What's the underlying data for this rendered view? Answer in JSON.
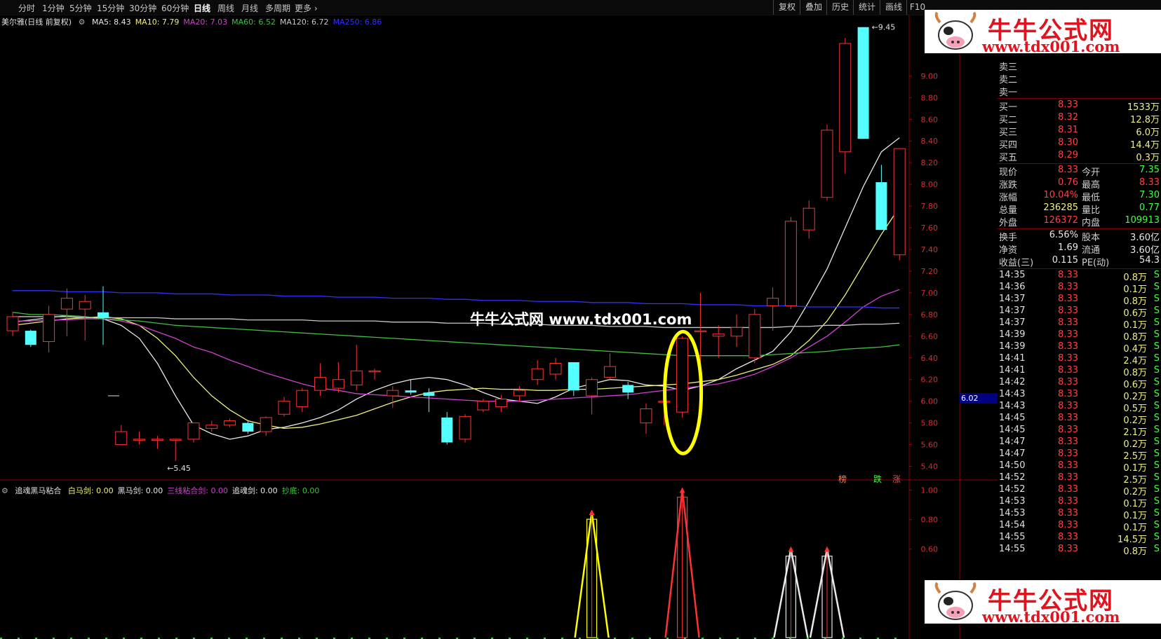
{
  "toolbar": {
    "periods": [
      "分时",
      "1分钟",
      "5分钟",
      "15分钟",
      "30分钟",
      "60分钟",
      "日线",
      "周线",
      "月线",
      "多周期",
      "更多"
    ],
    "active": "日线",
    "right_buttons": [
      "复权",
      "叠加",
      "历史",
      "统计",
      "画线",
      "F10"
    ]
  },
  "ma_legend": {
    "stock": "美尔雅(日线 前复权)",
    "items": [
      {
        "label": "MA5: 8.43",
        "color": "#e8e8e8"
      },
      {
        "label": "MA10: 7.79",
        "color": "#f0f07a"
      },
      {
        "label": "MA20: 7.03",
        "color": "#d040d0"
      },
      {
        "label": "MA60: 6.52",
        "color": "#40c040"
      },
      {
        "label": "MA120: 6.72",
        "color": "#c8c8c8"
      },
      {
        "label": "MA250: 6.86",
        "color": "#3030ff"
      }
    ]
  },
  "indicator_legend": {
    "name": "追魂黑马粘合",
    "items": [
      {
        "label": "白马剑: 0.00",
        "color": "#f0f07a"
      },
      {
        "label": "黑马剑: 0.00",
        "color": "#e8e8e8"
      },
      {
        "label": "三线粘合剑: 0.00",
        "color": "#d040d0"
      },
      {
        "label": "追魂剑: 0.00",
        "color": "#e8e8e8"
      },
      {
        "label": "抄底: 0.00",
        "color": "#40c040"
      }
    ]
  },
  "price_axis": {
    "ticks": [
      "9.00",
      "8.80",
      "8.60",
      "8.40",
      "8.20",
      "8.00",
      "7.80",
      "7.60",
      "7.40",
      "7.20",
      "7.00",
      "6.80",
      "6.60",
      "6.40",
      "6.20",
      "6.00",
      "5.80",
      "5.60",
      "5.40"
    ],
    "current": "6.02"
  },
  "indicator_axis": {
    "ticks": [
      "1.00",
      "0.80",
      "0.60"
    ]
  },
  "annotations": {
    "high": "9.45",
    "low": "5.45"
  },
  "signals": [
    {
      "text": "榜",
      "color": "#ff8040"
    },
    {
      "text": "跌",
      "color": "#40ff40"
    },
    {
      "text": "涨",
      "color": "#ff4040"
    }
  ],
  "watermark": "牛牛公式网  www.tdx001.com",
  "logo": {
    "title": "牛牛公式网",
    "url": "www.tdx001.com"
  },
  "colors": {
    "up": "#ff3232",
    "down": "#54ffff",
    "bg": "#000000"
  },
  "chart_data": [
    {
      "type": "candlestick",
      "ylim": [
        5.3,
        9.5
      ],
      "candles": [
        {
          "o": 6.65,
          "c": 6.78,
          "h": 6.82,
          "l": 6.6
        },
        {
          "o": 6.65,
          "c": 6.52,
          "h": 6.66,
          "l": 6.5
        },
        {
          "o": 6.55,
          "c": 6.8,
          "h": 6.88,
          "l": 6.45
        },
        {
          "o": 6.85,
          "c": 6.95,
          "h": 7.04,
          "l": 6.6
        },
        {
          "o": 6.85,
          "c": 6.92,
          "h": 6.98,
          "l": 6.56
        },
        {
          "o": 6.82,
          "c": 6.77,
          "h": 7.06,
          "l": 6.52
        },
        {
          "o": 5.6,
          "c": 5.72,
          "h": 5.78,
          "l": 5.6
        },
        {
          "o": 5.65,
          "c": 5.65,
          "h": 5.72,
          "l": 5.6
        },
        {
          "o": 5.65,
          "c": 5.65,
          "h": 5.68,
          "l": 5.56
        },
        {
          "o": 5.65,
          "c": 5.65,
          "h": 5.65,
          "l": 5.45
        },
        {
          "o": 5.65,
          "c": 5.8,
          "h": 5.8,
          "l": 5.62
        },
        {
          "o": 5.75,
          "c": 5.78,
          "h": 5.82,
          "l": 5.72
        },
        {
          "o": 5.78,
          "c": 5.82,
          "h": 5.84,
          "l": 5.76
        },
        {
          "o": 5.8,
          "c": 5.72,
          "h": 5.82,
          "l": 5.7
        },
        {
          "o": 5.72,
          "c": 5.85,
          "h": 5.86,
          "l": 5.68
        },
        {
          "o": 5.88,
          "c": 6.0,
          "h": 6.04,
          "l": 5.86
        },
        {
          "o": 5.95,
          "c": 6.1,
          "h": 6.12,
          "l": 5.9
        },
        {
          "o": 6.1,
          "c": 6.22,
          "h": 6.35,
          "l": 6.05
        },
        {
          "o": 6.12,
          "c": 6.2,
          "h": 6.36,
          "l": 6.08
        },
        {
          "o": 6.15,
          "c": 6.28,
          "h": 6.52,
          "l": 6.1
        },
        {
          "o": 6.28,
          "c": 6.28,
          "h": 6.3,
          "l": 6.2
        },
        {
          "o": 6.05,
          "c": 6.1,
          "h": 6.14,
          "l": 5.94
        },
        {
          "o": 6.1,
          "c": 6.08,
          "h": 6.2,
          "l": 6.06
        },
        {
          "o": 6.08,
          "c": 6.05,
          "h": 6.12,
          "l": 5.9
        },
        {
          "o": 5.85,
          "c": 5.62,
          "h": 5.9,
          "l": 5.6
        },
        {
          "o": 5.65,
          "c": 5.86,
          "h": 5.88,
          "l": 5.62
        },
        {
          "o": 5.92,
          "c": 6.0,
          "h": 6.02,
          "l": 5.9
        },
        {
          "o": 5.95,
          "c": 6.02,
          "h": 6.06,
          "l": 5.9
        },
        {
          "o": 6.05,
          "c": 6.1,
          "h": 6.14,
          "l": 6.0
        },
        {
          "o": 6.2,
          "c": 6.3,
          "h": 6.38,
          "l": 6.15
        },
        {
          "o": 6.25,
          "c": 6.35,
          "h": 6.4,
          "l": 6.2
        },
        {
          "o": 6.36,
          "c": 6.1,
          "h": 6.36,
          "l": 6.05
        },
        {
          "o": 6.05,
          "c": 6.2,
          "h": 6.22,
          "l": 5.88
        },
        {
          "o": 6.22,
          "c": 6.32,
          "h": 6.44,
          "l": 6.2
        },
        {
          "o": 6.15,
          "c": 6.08,
          "h": 6.18,
          "l": 6.02
        },
        {
          "o": 5.8,
          "c": 5.93,
          "h": 5.98,
          "l": 5.7
        },
        {
          "o": 6.0,
          "c": 6.0,
          "h": 6.2,
          "l": 5.78
        },
        {
          "o": 5.9,
          "c": 6.58,
          "h": 6.6,
          "l": 5.85
        },
        {
          "o": 6.65,
          "c": 6.65,
          "h": 7.0,
          "l": 6.3
        },
        {
          "o": 6.6,
          "c": 6.62,
          "h": 6.7,
          "l": 6.4
        },
        {
          "o": 6.6,
          "c": 6.68,
          "h": 6.8,
          "l": 6.5
        },
        {
          "o": 6.4,
          "c": 6.8,
          "h": 6.85,
          "l": 6.35
        },
        {
          "o": 6.88,
          "c": 6.95,
          "h": 7.05,
          "l": 6.65
        },
        {
          "o": 6.88,
          "c": 7.66,
          "h": 7.7,
          "l": 6.85
        },
        {
          "o": 7.58,
          "c": 7.78,
          "h": 7.85,
          "l": 7.5
        },
        {
          "o": 7.88,
          "c": 8.5,
          "h": 8.55,
          "l": 7.85
        },
        {
          "o": 8.3,
          "c": 9.3,
          "h": 9.35,
          "l": 8.1
        },
        {
          "o": 9.45,
          "c": 8.42,
          "h": 9.45,
          "l": 8.42
        },
        {
          "o": 8.02,
          "c": 7.58,
          "h": 8.18,
          "l": 7.58
        },
        {
          "o": 7.35,
          "c": 8.33,
          "h": 8.33,
          "l": 7.3
        }
      ],
      "moving_averages": {
        "MA5": [
          6.73,
          6.75,
          6.77,
          6.79,
          6.78,
          6.76,
          6.7,
          6.58,
          6.35,
          6.05,
          5.78,
          5.7,
          5.65,
          5.68,
          5.74,
          5.76,
          5.8,
          5.85,
          5.92,
          6.02,
          6.1,
          6.16,
          6.2,
          6.22,
          6.2,
          6.15,
          6.08,
          6.02,
          6.0,
          5.98,
          6.04,
          6.12,
          6.16,
          6.2,
          6.19,
          6.15,
          6.14,
          6.1,
          6.14,
          6.2,
          6.3,
          6.38,
          6.46,
          6.64,
          6.92,
          7.22,
          7.6,
          7.98,
          8.3,
          8.43
        ],
        "MA10": [
          6.7,
          6.72,
          6.74,
          6.76,
          6.77,
          6.78,
          6.76,
          6.7,
          6.58,
          6.42,
          6.22,
          6.05,
          5.92,
          5.82,
          5.78,
          5.75,
          5.76,
          5.79,
          5.83,
          5.87,
          5.93,
          5.99,
          6.04,
          6.08,
          6.1,
          6.11,
          6.12,
          6.11,
          6.11,
          6.1,
          6.1,
          6.11,
          6.11,
          6.12,
          6.13,
          6.14,
          6.15,
          6.16,
          6.18,
          6.2,
          6.24,
          6.29,
          6.34,
          6.42,
          6.56,
          6.74,
          6.98,
          7.26,
          7.54,
          7.79
        ],
        "MA20": [
          6.74,
          6.74,
          6.75,
          6.75,
          6.76,
          6.76,
          6.74,
          6.7,
          6.64,
          6.58,
          6.5,
          6.45,
          6.38,
          6.32,
          6.26,
          6.21,
          6.16,
          6.12,
          6.1,
          6.07,
          6.06,
          6.05,
          6.04,
          6.03,
          6.02,
          6.01,
          6.0,
          6.0,
          6.0,
          6.01,
          6.02,
          6.03,
          6.04,
          6.05,
          6.06,
          6.08,
          6.1,
          6.12,
          6.14,
          6.16,
          6.2,
          6.25,
          6.32,
          6.4,
          6.5,
          6.6,
          6.73,
          6.87,
          6.97,
          7.03
        ],
        "MA60": [
          6.82,
          6.8,
          6.8,
          6.79,
          6.78,
          6.76,
          6.75,
          6.74,
          6.72,
          6.7,
          6.69,
          6.68,
          6.67,
          6.66,
          6.65,
          6.64,
          6.63,
          6.62,
          6.61,
          6.6,
          6.59,
          6.58,
          6.57,
          6.56,
          6.55,
          6.54,
          6.53,
          6.52,
          6.51,
          6.5,
          6.49,
          6.48,
          6.47,
          6.46,
          6.45,
          6.44,
          6.43,
          6.42,
          6.42,
          6.42,
          6.42,
          6.42,
          6.43,
          6.44,
          6.45,
          6.46,
          6.48,
          6.49,
          6.5,
          6.52
        ],
        "MA120": [
          6.78,
          6.78,
          6.78,
          6.78,
          6.77,
          6.77,
          6.77,
          6.77,
          6.77,
          6.76,
          6.76,
          6.76,
          6.76,
          6.75,
          6.75,
          6.75,
          6.75,
          6.74,
          6.74,
          6.74,
          6.74,
          6.73,
          6.73,
          6.73,
          6.72,
          6.72,
          6.72,
          6.71,
          6.71,
          6.71,
          6.7,
          6.7,
          6.7,
          6.69,
          6.69,
          6.69,
          6.68,
          6.68,
          6.68,
          6.68,
          6.68,
          6.68,
          6.68,
          6.69,
          6.69,
          6.7,
          6.7,
          6.71,
          6.71,
          6.72
        ],
        "MA250": [
          7.02,
          7.02,
          7.02,
          7.01,
          7.01,
          7.01,
          7.0,
          7.0,
          7.0,
          6.99,
          6.99,
          6.99,
          6.98,
          6.98,
          6.98,
          6.97,
          6.97,
          6.97,
          6.96,
          6.96,
          6.96,
          6.95,
          6.95,
          6.95,
          6.94,
          6.94,
          6.93,
          6.93,
          6.93,
          6.92,
          6.92,
          6.92,
          6.91,
          6.91,
          6.91,
          6.9,
          6.9,
          6.9,
          6.89,
          6.89,
          6.89,
          6.88,
          6.88,
          6.88,
          6.87,
          6.87,
          6.87,
          6.87,
          6.86,
          6.86
        ]
      }
    },
    {
      "type": "bar",
      "name": "追魂黑马粘合",
      "ylim": [
        0,
        1.05
      ],
      "peaks": [
        {
          "index": 32,
          "value": 0.85,
          "color": "#ffff00"
        },
        {
          "index": 37,
          "value": 1.0,
          "color": "#ff3232"
        },
        {
          "index": 43,
          "value": 0.6,
          "color": "#e8e8e8"
        },
        {
          "index": 45,
          "value": 0.6,
          "color": "#e8e8e8"
        }
      ]
    }
  ],
  "order_book": {
    "asks": [
      {
        "label": "卖三",
        "price": "",
        "vol": ""
      },
      {
        "label": "卖二",
        "price": "",
        "vol": ""
      },
      {
        "label": "卖一",
        "price": "",
        "vol": ""
      }
    ],
    "bids": [
      {
        "label": "买一",
        "price": "8.33",
        "vol": "1533万"
      },
      {
        "label": "买二",
        "price": "8.32",
        "vol": "12.8万"
      },
      {
        "label": "买三",
        "price": "8.31",
        "vol": "6.0万"
      },
      {
        "label": "买四",
        "price": "8.30",
        "vol": "14.4万"
      },
      {
        "label": "买五",
        "price": "8.29",
        "vol": "0.3万"
      }
    ]
  },
  "quote": [
    {
      "l1": "现价",
      "v1": "8.33",
      "c1": "#ff4040",
      "l2": "今开",
      "v2": "7.35",
      "c2": "#40ff40"
    },
    {
      "l1": "涨跌",
      "v1": "0.76",
      "c1": "#ff4040",
      "l2": "最高",
      "v2": "8.33",
      "c2": "#ff4040"
    },
    {
      "l1": "涨幅",
      "v1": "10.04%",
      "c1": "#ff4040",
      "l2": "最低",
      "v2": "7.30",
      "c2": "#40ff40"
    },
    {
      "l1": "总量",
      "v1": "236285",
      "c1": "#f0f07a",
      "l2": "量比",
      "v2": "0.77",
      "c2": "#40ff40"
    },
    {
      "l1": "外盘",
      "v1": "126372",
      "c1": "#ff4040",
      "l2": "内盘",
      "v2": "109913",
      "c2": "#40ff40"
    }
  ],
  "fundamentals": [
    {
      "l1": "换手",
      "v1": "6.56%",
      "l2": "股本",
      "v2": "3.60亿"
    },
    {
      "l1": "净资",
      "v1": "1.69",
      "l2": "流通",
      "v2": "3.60亿"
    },
    {
      "l1": "收益(三)",
      "v1": "0.115",
      "l2": "PE(动)",
      "v2": "54.3"
    }
  ],
  "ticks": [
    {
      "time": "14:35",
      "price": "8.33",
      "vol": "0.8万",
      "side": "S"
    },
    {
      "time": "14:36",
      "price": "8.33",
      "vol": "0.1万",
      "side": "S"
    },
    {
      "time": "14:37",
      "price": "8.33",
      "vol": "0.8万",
      "side": "S"
    },
    {
      "time": "14:37",
      "price": "8.33",
      "vol": "0.6万",
      "side": "S"
    },
    {
      "time": "14:37",
      "price": "8.33",
      "vol": "0.1万",
      "side": "S"
    },
    {
      "time": "14:39",
      "price": "8.33",
      "vol": "0.8万",
      "side": "S"
    },
    {
      "time": "14:39",
      "price": "8.33",
      "vol": "0.4万",
      "side": "S"
    },
    {
      "time": "14:41",
      "price": "8.33",
      "vol": "2.4万",
      "side": "S"
    },
    {
      "time": "14:41",
      "price": "8.33",
      "vol": "0.8万",
      "side": "S"
    },
    {
      "time": "14:42",
      "price": "8.33",
      "vol": "0.6万",
      "side": "S"
    },
    {
      "time": "14:43",
      "price": "8.33",
      "vol": "0.2万",
      "side": "S"
    },
    {
      "time": "14:43",
      "price": "8.33",
      "vol": "0.5万",
      "side": "S"
    },
    {
      "time": "14:45",
      "price": "8.33",
      "vol": "0.2万",
      "side": "S"
    },
    {
      "time": "14:45",
      "price": "8.33",
      "vol": "2.1万",
      "side": "S"
    },
    {
      "time": "14:47",
      "price": "8.33",
      "vol": "0.2万",
      "side": "S"
    },
    {
      "time": "14:47",
      "price": "8.33",
      "vol": "2.5万",
      "side": "S"
    },
    {
      "time": "14:50",
      "price": "8.33",
      "vol": "0.1万",
      "side": "S"
    },
    {
      "time": "14:52",
      "price": "8.33",
      "vol": "2.5万",
      "side": "S"
    },
    {
      "time": "14:52",
      "price": "8.33",
      "vol": "0.2万",
      "side": "S"
    },
    {
      "time": "14:53",
      "price": "8.33",
      "vol": "0.1万",
      "side": "S"
    },
    {
      "time": "14:53",
      "price": "8.33",
      "vol": "0.1万",
      "side": "S"
    },
    {
      "time": "14:54",
      "price": "8.33",
      "vol": "0.1万",
      "side": "S"
    },
    {
      "time": "14:55",
      "price": "8.33",
      "vol": "14.5万",
      "side": "S"
    },
    {
      "time": "14:55",
      "price": "8.33",
      "vol": "0.8万",
      "side": "S"
    }
  ]
}
